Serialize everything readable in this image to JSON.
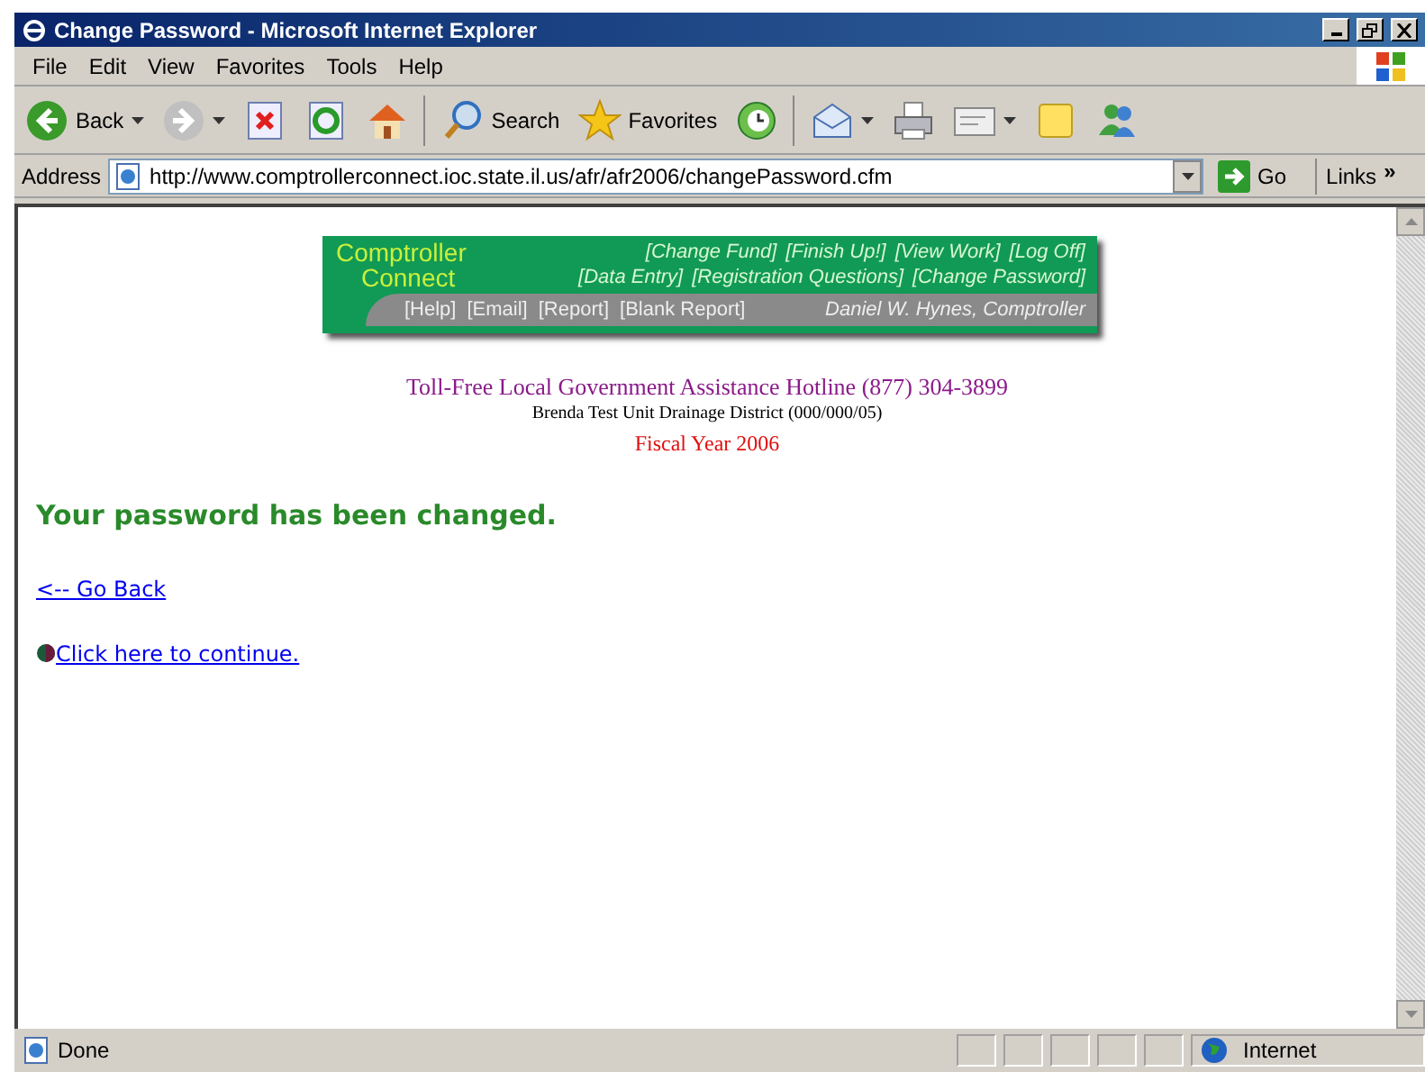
{
  "window": {
    "title": "Change Password - Microsoft Internet Explorer"
  },
  "menu": [
    "File",
    "Edit",
    "View",
    "Favorites",
    "Tools",
    "Help"
  ],
  "toolbar": [
    {
      "kind": "back",
      "label": "Back",
      "dropdown": true
    },
    {
      "kind": "forward",
      "dropdown": true
    },
    {
      "kind": "stop"
    },
    {
      "kind": "refresh"
    },
    {
      "kind": "home",
      "sep_after": true
    },
    {
      "kind": "search",
      "label": "Search"
    },
    {
      "kind": "favorites",
      "label": "Favorites"
    },
    {
      "kind": "history",
      "sep_after": true
    },
    {
      "kind": "mail",
      "dropdown": true
    },
    {
      "kind": "print"
    },
    {
      "kind": "edit",
      "dropdown": true
    },
    {
      "kind": "note"
    },
    {
      "kind": "messenger"
    }
  ],
  "address": {
    "label": "Address",
    "url": "http://www.comptrollerconnect.ioc.state.il.us/afr/afr2006/changePassword.cfm",
    "go": "Go",
    "links": "Links",
    "more": "»"
  },
  "banner": {
    "logo": [
      "Comptroller",
      "Connect"
    ],
    "nav_rows": [
      [
        "[Change Fund]",
        "[Finish Up!]",
        "[View Work]",
        "[Log Off]"
      ],
      [
        "[Data Entry]",
        "[Registration Questions]",
        "[Change Password]"
      ]
    ],
    "tools": [
      "[Help]",
      "[Email]",
      "[Report]",
      "[Blank Report]"
    ],
    "credit": "Daniel W. Hynes, Comptroller"
  },
  "hotline": "Toll-Free Local Government Assistance Hotline (877) 304-3899",
  "district": "Brenda Test Unit Drainage District (000/000/05)",
  "fiscal_year": "Fiscal Year 2006",
  "message": "Your password has been changed.",
  "back_link": "<-- Go Back",
  "continue_link": "Click here to continue.",
  "status": {
    "text": "Done",
    "zone": "Internet"
  }
}
